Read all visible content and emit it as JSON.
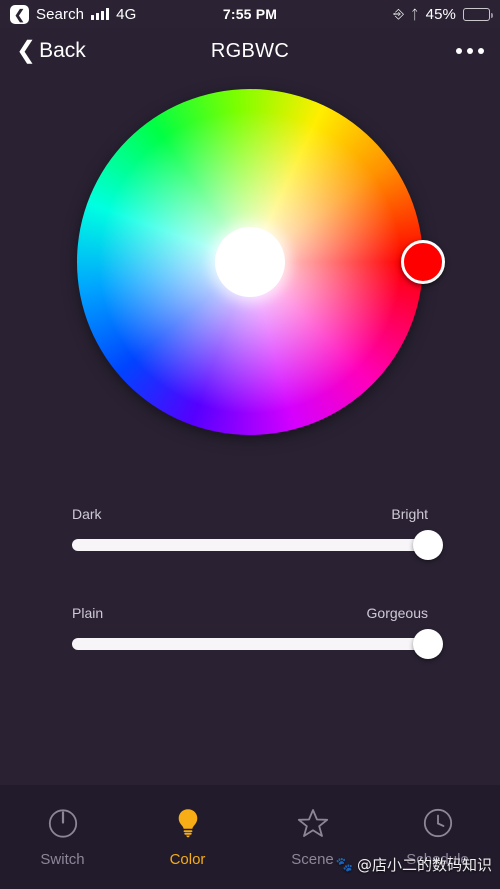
{
  "statusbar": {
    "back_label": "Search",
    "back_icon": "chevron-left-icon",
    "signal_icon": "cellular-bars-icon",
    "network": "4G",
    "time": "7:55 PM",
    "orientation_lock_icon": "rotation-lock-icon",
    "bluetooth_icon": "bluetooth-icon",
    "battery_percent": "45%",
    "battery_level": 45,
    "battery_color": "#f5c518"
  },
  "navbar": {
    "back_label": "Back",
    "back_icon": "chevron-left-icon",
    "title": "RGBWC",
    "more_icon": "ellipsis-icon"
  },
  "color_picker": {
    "name": "color-wheel",
    "selected_color": "#ff0000",
    "handle_angle_deg": 0,
    "center_color": "#ffffff"
  },
  "sliders": [
    {
      "name": "brightness-slider",
      "left_label": "Dark",
      "right_label": "Bright",
      "value": 100
    },
    {
      "name": "saturation-slider",
      "left_label": "Plain",
      "right_label": "Gorgeous",
      "value": 100
    }
  ],
  "tabs": [
    {
      "label": "Switch",
      "icon": "power-icon",
      "active": false
    },
    {
      "label": "Color",
      "icon": "lightbulb-icon",
      "active": true
    },
    {
      "label": "Scene",
      "icon": "star-icon",
      "active": false
    },
    {
      "label": "Schedule",
      "icon": "clock-icon",
      "active": false
    }
  ],
  "watermark": {
    "logo": "baidu-paw-icon",
    "text": "@店小二的数码知识"
  },
  "theme": {
    "background": "#2a2233",
    "tabbar_background": "#221b2b",
    "accent": "#f6ad16",
    "inactive": "#8d8699"
  }
}
